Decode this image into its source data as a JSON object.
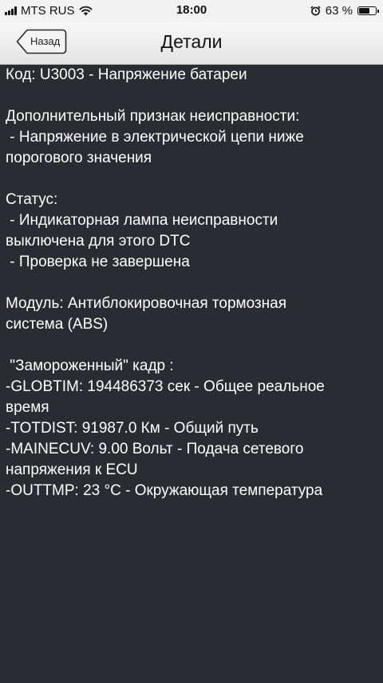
{
  "status_bar": {
    "carrier": "MTS RUS",
    "time": "18:00",
    "battery_percent_label": "63 %",
    "battery_level": 0.63,
    "icons": [
      "signal-icon",
      "wifi-icon",
      "alarm-icon",
      "battery-icon"
    ]
  },
  "nav": {
    "back_label": "Назад",
    "title": "Детали"
  },
  "details": {
    "lines": [
      "Код: U3003 - Напряжение батареи",
      "",
      "Дополнительный признак неисправности:",
      " - Напряжение в электрической цепи ниже",
      "порогового значения",
      "",
      "Статус:",
      " - Индикаторная лампа неисправности",
      "выключена для этого DTC",
      " - Проверка не завершена",
      "",
      "Модуль: Антиблокировочная тормозная",
      "система (ABS)",
      "",
      " \"Замороженный\" кадр :",
      "-GLOBTIM: 194486373 сек - Общее реальное",
      "время",
      "-TOTDIST: 91987.0 Км - Общий путь",
      "-MAINECUV: 9.00 Вольт - Подача сетевого",
      "напряжения к ECU",
      "-OUTTMP: 23 °C - Окружающая температура"
    ]
  },
  "colors": {
    "background": "#2b2c31",
    "text": "#ffffff",
    "nav_bar": "#ececec",
    "status_bar": "#f2f2f2"
  }
}
